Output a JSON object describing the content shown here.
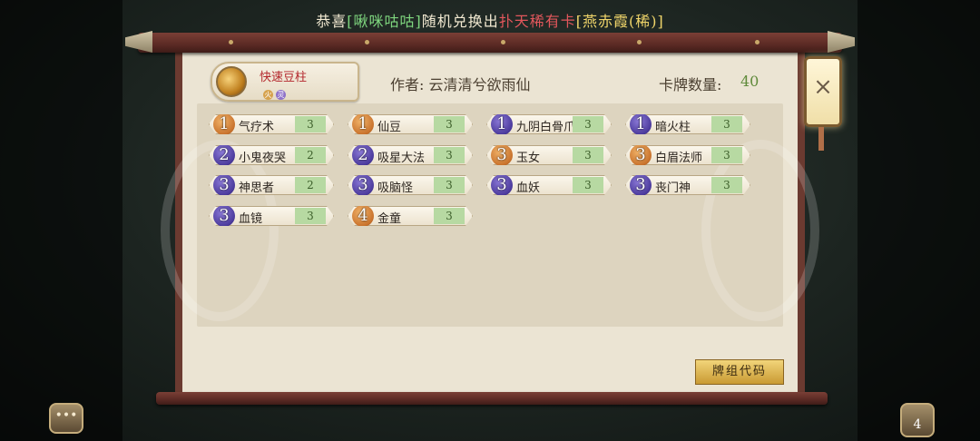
{
  "announcement": {
    "prefix": "恭喜",
    "player": "[啾咪咕咕]",
    "middle": "随机兑换出",
    "rarity": "扑天稀有卡",
    "card": "[燕赤霞(稀)]"
  },
  "deck": {
    "name": "快速豆柱",
    "tags": [
      "火",
      "灵"
    ],
    "author_label": "作者: 云清清兮欲雨仙",
    "count_label": "卡牌数量:",
    "count_value": "40"
  },
  "cards": [
    {
      "cost": "1",
      "name": "气疗术",
      "count": "3",
      "color": "orange"
    },
    {
      "cost": "1",
      "name": "仙豆",
      "count": "3",
      "color": "orange"
    },
    {
      "cost": "1",
      "name": "九阴白骨爪",
      "count": "3",
      "color": "purple"
    },
    {
      "cost": "1",
      "name": "暗火柱",
      "count": "3",
      "color": "purple"
    },
    {
      "cost": "2",
      "name": "小鬼夜哭",
      "count": "2",
      "color": "purple"
    },
    {
      "cost": "2",
      "name": "吸星大法",
      "count": "3",
      "color": "purple"
    },
    {
      "cost": "3",
      "name": "玉女",
      "count": "3",
      "color": "orange"
    },
    {
      "cost": "3",
      "name": "白眉法师",
      "count": "3",
      "color": "orange"
    },
    {
      "cost": "3",
      "name": "神思者",
      "count": "2",
      "color": "purple"
    },
    {
      "cost": "3",
      "name": "吸脑怪",
      "count": "3",
      "color": "purple"
    },
    {
      "cost": "3",
      "name": "血妖",
      "count": "3",
      "color": "purple"
    },
    {
      "cost": "3",
      "name": "丧门神",
      "count": "3",
      "color": "purple"
    },
    {
      "cost": "3",
      "name": "血镜",
      "count": "3",
      "color": "purple"
    },
    {
      "cost": "4",
      "name": "金童",
      "count": "3",
      "color": "orange"
    }
  ],
  "buttons": {
    "deck_code": "牌组代码",
    "close_icon": "×",
    "chat_icon": "•••",
    "gift_count": "4"
  }
}
